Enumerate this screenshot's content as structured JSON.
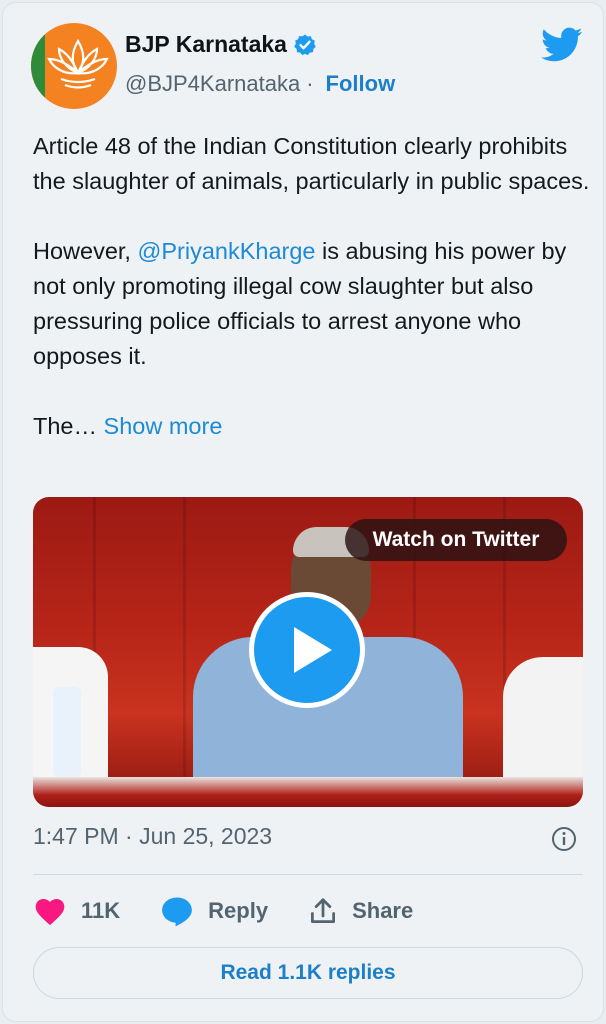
{
  "author": {
    "name": "BJP Karnataka",
    "handle": "@BJP4Karnataka",
    "separator": "·",
    "follow_label": "Follow",
    "avatar_colors": {
      "saffron": "#f58220",
      "green": "#2e8b3a"
    }
  },
  "tweet": {
    "p1": "Article 48 of the Indian Constitution clearly prohibits the slaughter of animals, particularly in public spaces.",
    "p2_before": "However, ",
    "p2_mention": "@PriyankKharge",
    "p2_after": " is abusing his power by not only promoting illegal cow slaughter but also pressuring police officials to arrest anyone who opposes it.",
    "p3": "The… ",
    "show_more": "Show more"
  },
  "media": {
    "watch_label": "Watch on Twitter",
    "play_icon": "play-icon"
  },
  "meta": {
    "timestamp": "1:47 PM · Jun 25, 2023"
  },
  "actions": {
    "likes": "11K",
    "reply_label": "Reply",
    "share_label": "Share"
  },
  "read_replies_label": "Read 1.1K replies",
  "colors": {
    "accent": "#1d9bf0",
    "like": "#f91880"
  }
}
